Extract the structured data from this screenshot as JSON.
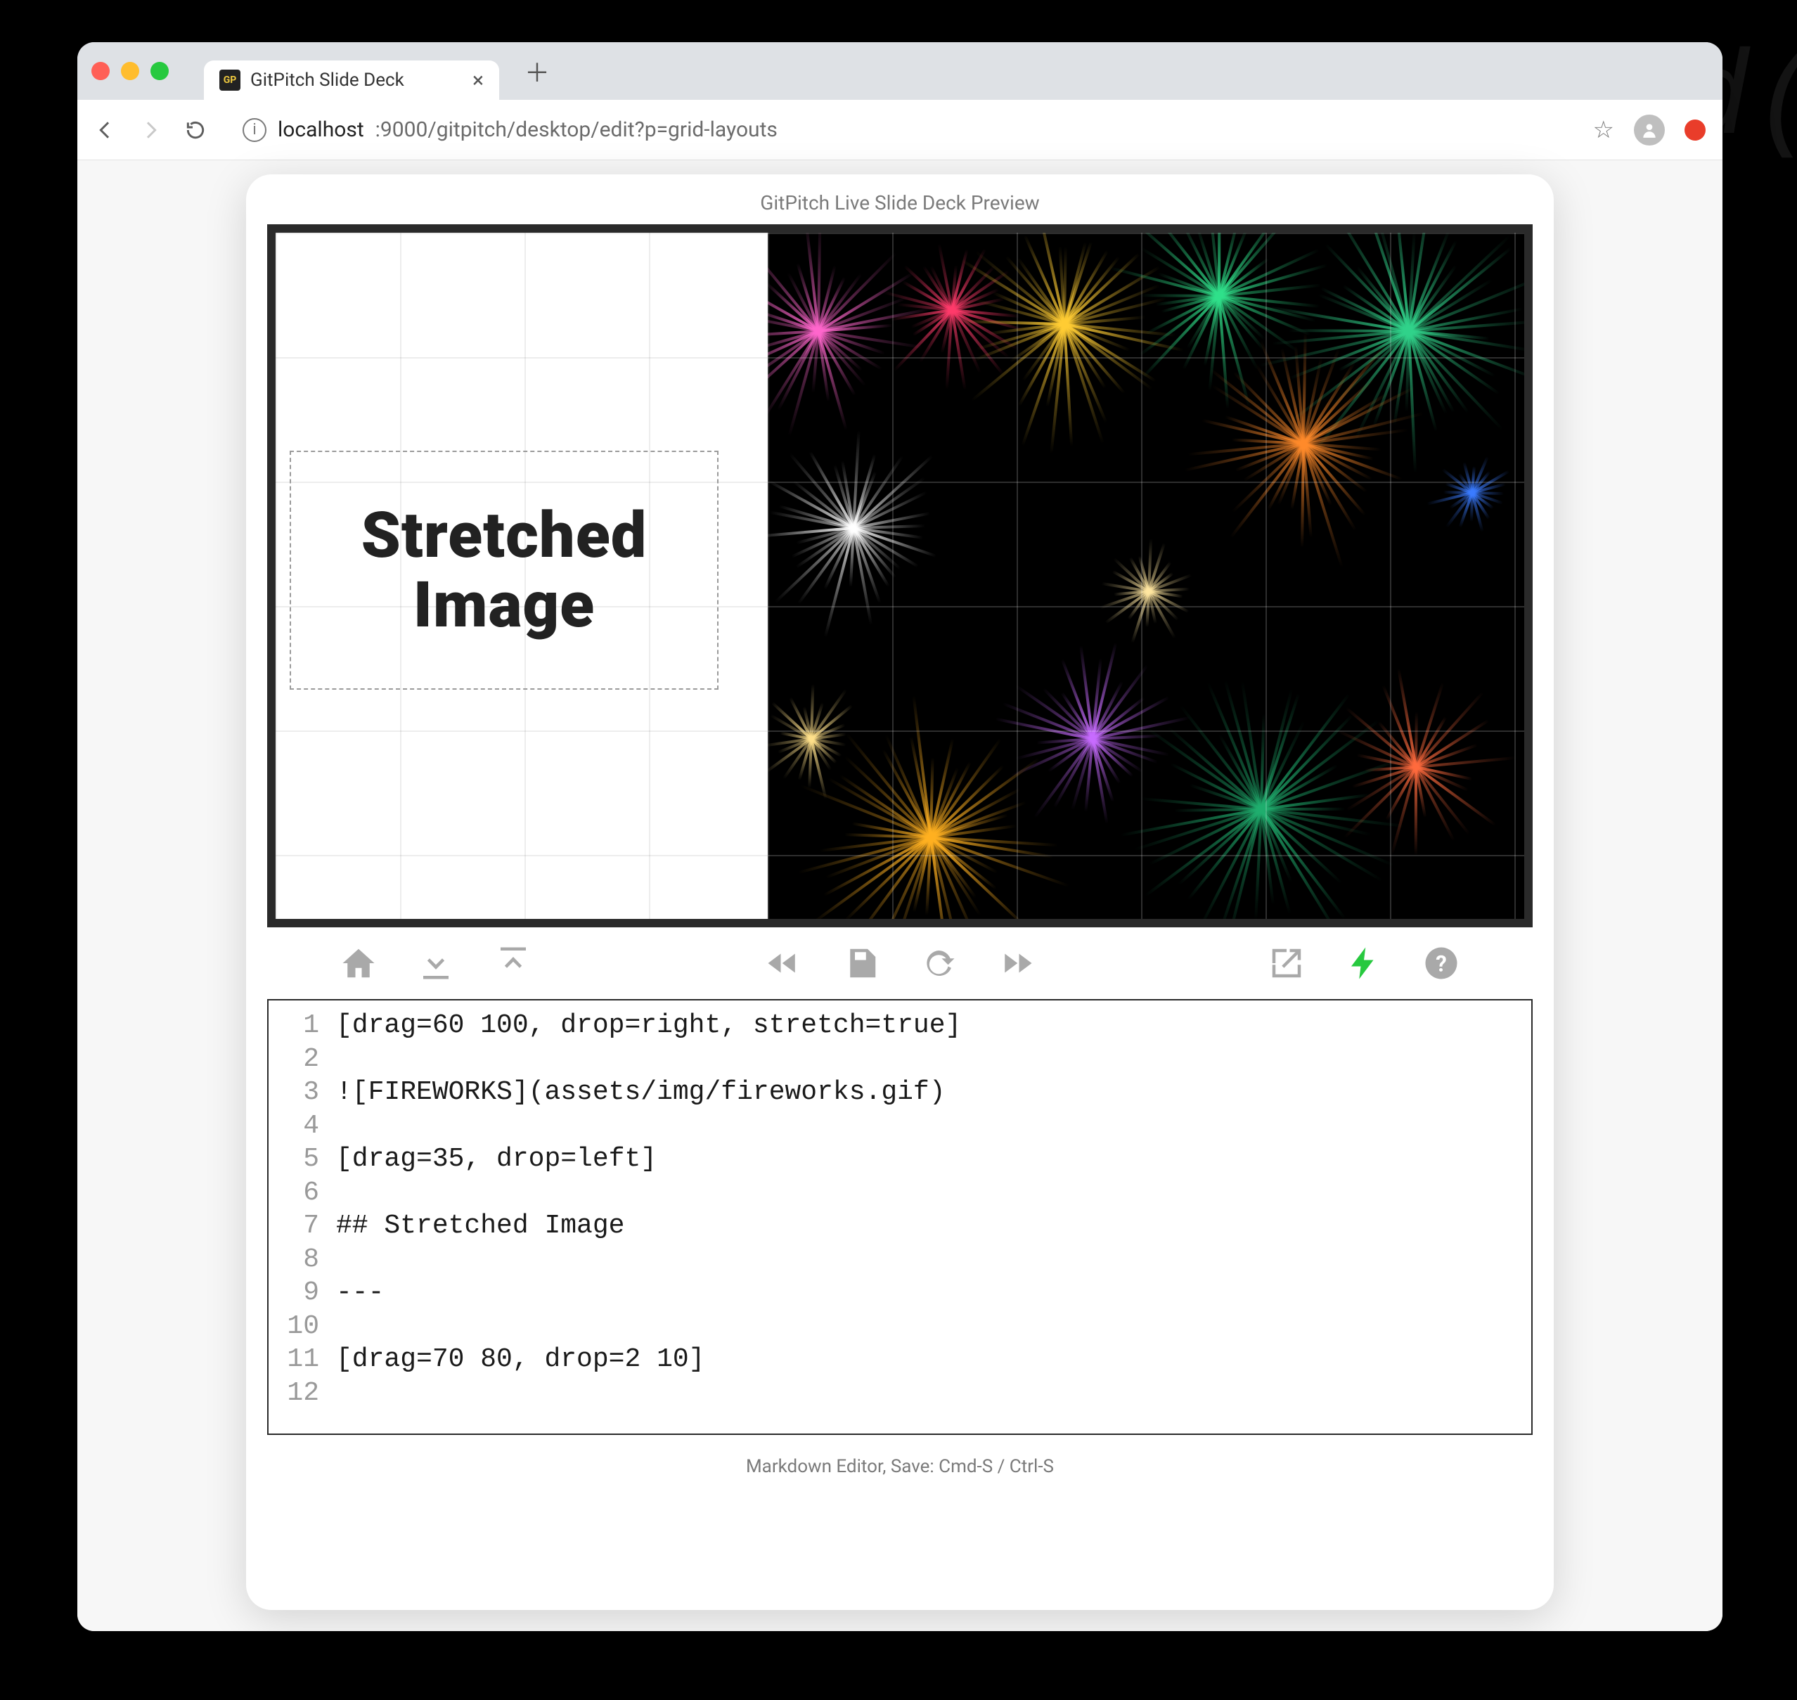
{
  "browser": {
    "tab": {
      "title": "GitPitch Slide Deck",
      "favicon_text": "GP"
    },
    "url": {
      "host": "localhost",
      "port_path": ":9000/gitpitch/desktop/edit?p=grid-layouts"
    }
  },
  "panel": {
    "header": "GitPitch Live Slide Deck Preview",
    "footer": "Markdown Editor, Save: Cmd-S / Ctrl-S"
  },
  "slide": {
    "title_line1": "Stretched",
    "title_line2": "Image"
  },
  "toolbar": {
    "home": "home",
    "download": "download",
    "upload": "upload",
    "prev": "rewind",
    "save": "save",
    "refresh": "refresh",
    "next": "forward",
    "popout": "external",
    "bolt": "bolt",
    "help": "help"
  },
  "editor": {
    "lines": [
      "[drag=60 100, drop=right, stretch=true]",
      "",
      "![FIREWORKS](assets/img/fireworks.gif)",
      "",
      "[drag=35, drop=left]",
      "",
      "## Stretched Image",
      "",
      "---",
      "",
      "[drag=70 80, drop=2 10]",
      ""
    ]
  },
  "bg_ghost_text": "et\npa\nnar\ned("
}
